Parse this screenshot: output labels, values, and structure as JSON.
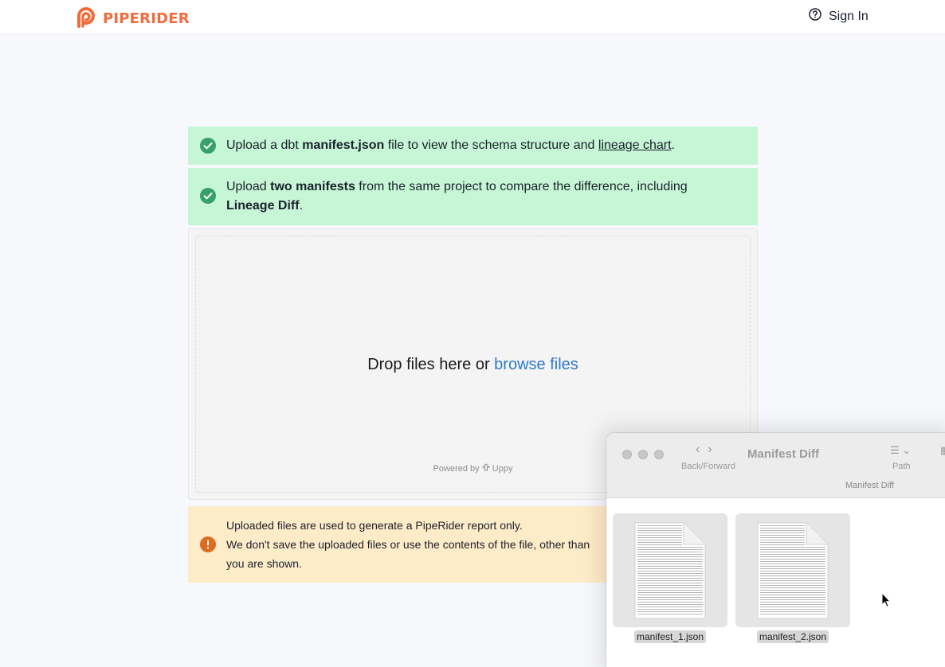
{
  "header": {
    "logo_text": "PIPERIDER",
    "sign_in_label": "Sign In"
  },
  "alerts": [
    {
      "before": "Upload a dbt ",
      "bold": "manifest.json",
      "middle": " file to view the schema structure and ",
      "link": "lineage chart",
      "after": "."
    },
    {
      "before": "Upload ",
      "bold": "two manifests",
      "middle": " from the same project to compare the difference, including ",
      "bold2": "Lineage Diff",
      "after": "."
    }
  ],
  "dropzone": {
    "prompt": "Drop files here or ",
    "browse_label": "browse files",
    "powered_by": "Powered by",
    "powered_brand": "Uppy"
  },
  "warning": {
    "line1": "Uploaded files are used to generate a PipeRider report only.",
    "line2": "We don't save the uploaded files or use the contents of the file, other than",
    "line3": "you are shown."
  },
  "finder": {
    "title": "Manifest Diff",
    "subtitle": "Manifest Diff",
    "back_forward_label": "Back/Forward",
    "path_label": "Path",
    "files": [
      "manifest_1.json",
      "manifest_2.json"
    ]
  },
  "colors": {
    "brand": "#f26b3a",
    "success_bg": "#c6f6d5",
    "success_icon": "#38a169",
    "warning_bg": "#feebc8",
    "warning_icon": "#dd6b20",
    "link": "#2f7ac8"
  },
  "icons": {
    "logo": "piperider-logo-icon",
    "sign_in": "help-circle-icon",
    "alert": "check-circle-icon",
    "warning": "exclamation-circle-icon"
  }
}
